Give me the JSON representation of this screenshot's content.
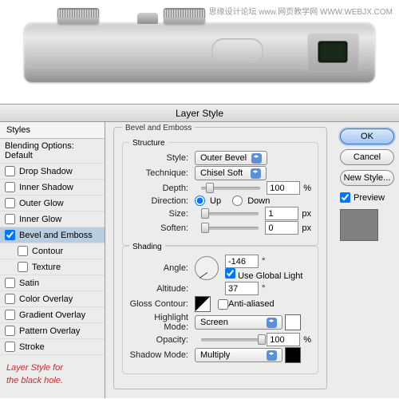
{
  "watermark": "思缘设计论坛  www.网页教学网  WWW.WEBJX.COM",
  "caption_l1": "Layer Style for",
  "caption_l2": "the black hole.",
  "dialog_title": "Layer Style",
  "styles_header": "Styles",
  "blending_default": "Blending Options: Default",
  "styles": {
    "drop_shadow": "Drop Shadow",
    "inner_shadow": "Inner Shadow",
    "outer_glow": "Outer Glow",
    "inner_glow": "Inner Glow",
    "bevel_emboss": "Bevel and Emboss",
    "contour": "Contour",
    "texture": "Texture",
    "satin": "Satin",
    "color_overlay": "Color Overlay",
    "gradient_overlay": "Gradient Overlay",
    "pattern_overlay": "Pattern Overlay",
    "stroke": "Stroke"
  },
  "panel_title": "Bevel and Emboss",
  "structure": {
    "legend": "Structure",
    "style_lbl": "Style:",
    "style_val": "Outer Bevel",
    "technique_lbl": "Technique:",
    "technique_val": "Chisel Soft",
    "depth_lbl": "Depth:",
    "depth_val": "100",
    "depth_unit": "%",
    "direction_lbl": "Direction:",
    "up": "Up",
    "down": "Down",
    "size_lbl": "Size:",
    "size_val": "1",
    "size_unit": "px",
    "soften_lbl": "Soften:",
    "soften_val": "0",
    "soften_unit": "px"
  },
  "shading": {
    "legend": "Shading",
    "angle_lbl": "Angle:",
    "angle_val": "-146",
    "angle_unit": "°",
    "global_light": "Use Global Light",
    "altitude_lbl": "Altitude:",
    "altitude_val": "37",
    "altitude_unit": "°",
    "gloss_lbl": "Gloss Contour:",
    "antialiased": "Anti-aliased",
    "highlight_mode_lbl": "Highlight Mode:",
    "highlight_mode_val": "Screen",
    "highlight_color": "#ffffff",
    "opacity_lbl": "Opacity:",
    "highlight_opacity": "100",
    "opacity_unit": "%",
    "shadow_mode_lbl": "Shadow Mode:",
    "shadow_mode_val": "Multiply",
    "shadow_color": "#000000"
  },
  "buttons": {
    "ok": "OK",
    "cancel": "Cancel",
    "new_style": "New Style...",
    "preview": "Preview"
  }
}
